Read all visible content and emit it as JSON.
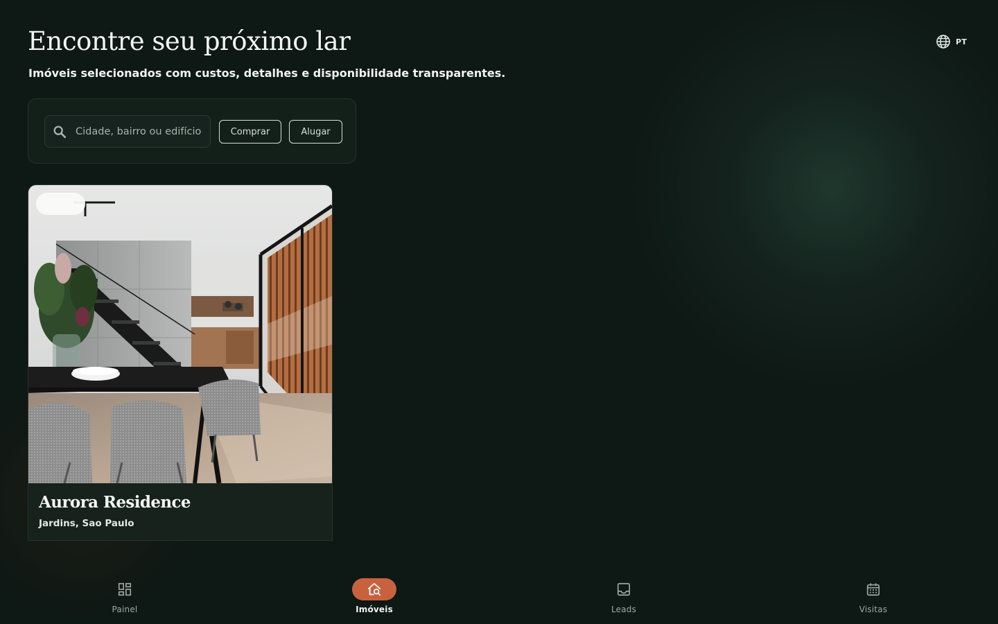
{
  "header": {
    "title": "Encontre seu próximo lar",
    "subtitle": "Imóveis selecionados com custos, detalhes e disponibilidade transparentes."
  },
  "language": {
    "icon": "globe-icon",
    "label": "PT"
  },
  "search": {
    "icon": "search-icon",
    "placeholder": "Cidade, bairro ou edifício",
    "value": ""
  },
  "filters": {
    "buy_label": "Comprar",
    "rent_label": "Alugar"
  },
  "listings": [
    {
      "name": "Aurora Residence",
      "location": "Jardins, Sao Paulo",
      "photo": "dining-room-photo"
    }
  ],
  "nav": {
    "items": [
      {
        "label": "Painel",
        "icon": "dashboard-icon",
        "active": false
      },
      {
        "label": "Imóveis",
        "icon": "home-search-icon",
        "active": true
      },
      {
        "label": "Leads",
        "icon": "inbox-icon",
        "active": false
      },
      {
        "label": "Visitas",
        "icon": "calendar-icon",
        "active": false
      }
    ]
  },
  "colors": {
    "background": "#0e1815",
    "panel": "#132019",
    "accent": "#c8623e",
    "text": "#f4f5f3",
    "muted": "#9ea8a3"
  }
}
